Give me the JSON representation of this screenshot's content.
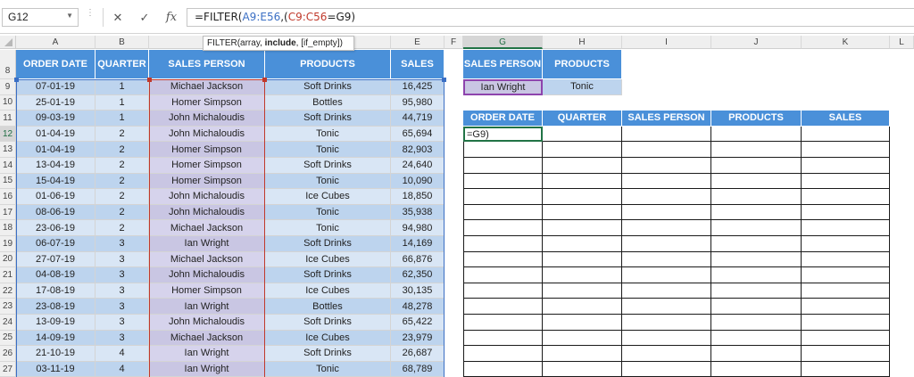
{
  "formula_bar": {
    "name_box": "G12",
    "cancel_icon": "✕",
    "enter_icon": "✓",
    "fx_label": "fx",
    "formula_prefix": "=FILTER(",
    "formula_ref1": "A9:E56",
    "formula_mid": ",(",
    "formula_ref2": "C9:C56",
    "formula_suffix": "=G9)"
  },
  "tooltip": {
    "func": "FILTER(array, ",
    "bold": "include",
    "rest": ", [if_empty])"
  },
  "columns": [
    "A",
    "B",
    "C",
    "D",
    "E",
    "F",
    "G",
    "H",
    "I",
    "J",
    "K",
    "L"
  ],
  "selected_column": "G",
  "selected_row": "12",
  "row_numbers": [
    "8",
    "9",
    "10",
    "11",
    "12",
    "13",
    "14",
    "15",
    "16",
    "17",
    "18",
    "19",
    "20",
    "21",
    "22",
    "23",
    "24",
    "25",
    "26",
    "27"
  ],
  "source_table": {
    "headers": [
      "ORDER DATE",
      "QUARTER",
      "SALES PERSON",
      "PRODUCTS",
      "SALES"
    ],
    "rows": [
      [
        "07-01-19",
        "1",
        "Michael Jackson",
        "Soft Drinks",
        "16,425"
      ],
      [
        "25-01-19",
        "1",
        "Homer Simpson",
        "Bottles",
        "95,980"
      ],
      [
        "09-03-19",
        "1",
        "John Michaloudis",
        "Soft Drinks",
        "44,719"
      ],
      [
        "01-04-19",
        "2",
        "John Michaloudis",
        "Tonic",
        "65,694"
      ],
      [
        "01-04-19",
        "2",
        "Homer Simpson",
        "Tonic",
        "82,903"
      ],
      [
        "13-04-19",
        "2",
        "Homer Simpson",
        "Soft Drinks",
        "24,640"
      ],
      [
        "15-04-19",
        "2",
        "Homer Simpson",
        "Tonic",
        "10,090"
      ],
      [
        "01-06-19",
        "2",
        "John Michaloudis",
        "Ice Cubes",
        "18,850"
      ],
      [
        "08-06-19",
        "2",
        "John Michaloudis",
        "Tonic",
        "35,938"
      ],
      [
        "23-06-19",
        "2",
        "Michael Jackson",
        "Tonic",
        "94,980"
      ],
      [
        "06-07-19",
        "3",
        "Ian Wright",
        "Soft Drinks",
        "14,169"
      ],
      [
        "27-07-19",
        "3",
        "Michael Jackson",
        "Ice Cubes",
        "66,876"
      ],
      [
        "04-08-19",
        "3",
        "John Michaloudis",
        "Soft Drinks",
        "62,350"
      ],
      [
        "17-08-19",
        "3",
        "Homer Simpson",
        "Ice Cubes",
        "30,135"
      ],
      [
        "23-08-19",
        "3",
        "Ian Wright",
        "Bottles",
        "48,278"
      ],
      [
        "13-09-19",
        "3",
        "John Michaloudis",
        "Soft Drinks",
        "65,422"
      ],
      [
        "14-09-19",
        "3",
        "Michael Jackson",
        "Ice Cubes",
        "23,979"
      ],
      [
        "21-10-19",
        "4",
        "Ian Wright",
        "Soft Drinks",
        "26,687"
      ],
      [
        "03-11-19",
        "4",
        "Ian Wright",
        "Tonic",
        "68,789"
      ]
    ]
  },
  "criteria": {
    "headers": [
      "SALES PERSON",
      "PRODUCTS"
    ],
    "values": [
      "Ian Wright",
      "Tonic"
    ]
  },
  "result_table": {
    "headers": [
      "ORDER DATE",
      "QUARTER",
      "SALES PERSON",
      "PRODUCTS",
      "SALES"
    ],
    "active_cell_text": "=G9)"
  }
}
